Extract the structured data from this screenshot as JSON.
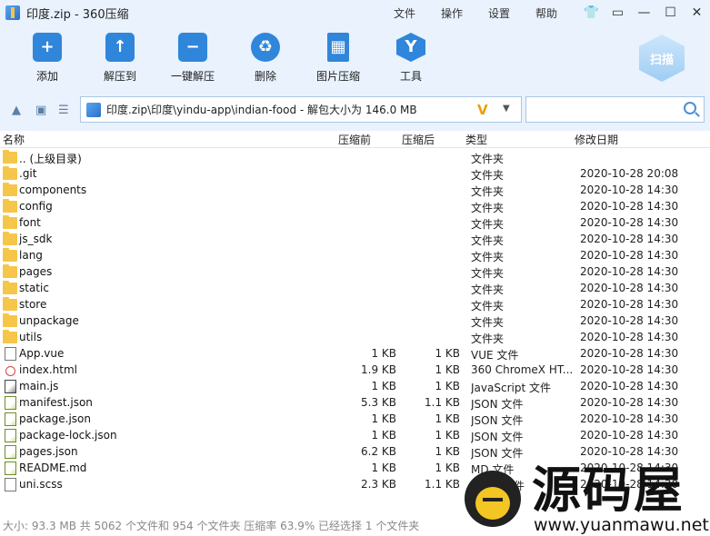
{
  "window": {
    "title": "印度.zip - 360压缩",
    "menu": [
      "文件",
      "操作",
      "设置",
      "帮助"
    ]
  },
  "toolbar": {
    "tools": [
      {
        "label": "添加",
        "icon": "add-icon"
      },
      {
        "label": "解压到",
        "icon": "extract-to-icon"
      },
      {
        "label": "一键解压",
        "icon": "one-click-extract-icon"
      },
      {
        "label": "删除",
        "icon": "trash-icon"
      },
      {
        "label": "图片压缩",
        "icon": "image-compress-icon"
      },
      {
        "label": "工具",
        "icon": "tools-icon"
      }
    ],
    "scan_label": "扫描"
  },
  "address": {
    "path": "印度.zip\\印度\\yindu-app\\indian-food - 解包大小为 146.0 MB",
    "search_placeholder": ""
  },
  "columns": {
    "name": "名称",
    "size": "压缩前",
    "compressed": "压缩后",
    "type": "类型",
    "date": "修改日期"
  },
  "rows": [
    {
      "name": ".. (上级目录)",
      "kind": "folder",
      "size": "",
      "compressed": "",
      "type": "文件夹",
      "date": ""
    },
    {
      "name": ".git",
      "kind": "folder",
      "size": "",
      "compressed": "",
      "type": "文件夹",
      "date": "2020-10-28 20:08"
    },
    {
      "name": "components",
      "kind": "folder",
      "size": "",
      "compressed": "",
      "type": "文件夹",
      "date": "2020-10-28 14:30"
    },
    {
      "name": "config",
      "kind": "folder",
      "size": "",
      "compressed": "",
      "type": "文件夹",
      "date": "2020-10-28 14:30"
    },
    {
      "name": "font",
      "kind": "folder",
      "size": "",
      "compressed": "",
      "type": "文件夹",
      "date": "2020-10-28 14:30"
    },
    {
      "name": "js_sdk",
      "kind": "folder",
      "size": "",
      "compressed": "",
      "type": "文件夹",
      "date": "2020-10-28 14:30"
    },
    {
      "name": "lang",
      "kind": "folder",
      "size": "",
      "compressed": "",
      "type": "文件夹",
      "date": "2020-10-28 14:30"
    },
    {
      "name": "pages",
      "kind": "folder",
      "size": "",
      "compressed": "",
      "type": "文件夹",
      "date": "2020-10-28 14:30"
    },
    {
      "name": "static",
      "kind": "folder",
      "size": "",
      "compressed": "",
      "type": "文件夹",
      "date": "2020-10-28 14:30"
    },
    {
      "name": "store",
      "kind": "folder",
      "size": "",
      "compressed": "",
      "type": "文件夹",
      "date": "2020-10-28 14:30"
    },
    {
      "name": "unpackage",
      "kind": "folder",
      "size": "",
      "compressed": "",
      "type": "文件夹",
      "date": "2020-10-28 14:30"
    },
    {
      "name": "utils",
      "kind": "folder",
      "size": "",
      "compressed": "",
      "type": "文件夹",
      "date": "2020-10-28 14:30"
    },
    {
      "name": "App.vue",
      "kind": "file",
      "size": "1 KB",
      "compressed": "1 KB",
      "type": "VUE 文件",
      "date": "2020-10-28 14:30"
    },
    {
      "name": "index.html",
      "kind": "html",
      "size": "1.9 KB",
      "compressed": "1 KB",
      "type": "360 ChromeX HT...",
      "date": "2020-10-28 14:30"
    },
    {
      "name": "main.js",
      "kind": "js",
      "size": "1 KB",
      "compressed": "1 KB",
      "type": "JavaScript 文件",
      "date": "2020-10-28 14:30"
    },
    {
      "name": "manifest.json",
      "kind": "json",
      "size": "5.3 KB",
      "compressed": "1.1 KB",
      "type": "JSON 文件",
      "date": "2020-10-28 14:30"
    },
    {
      "name": "package.json",
      "kind": "json",
      "size": "1 KB",
      "compressed": "1 KB",
      "type": "JSON 文件",
      "date": "2020-10-28 14:30"
    },
    {
      "name": "package-lock.json",
      "kind": "json",
      "size": "1 KB",
      "compressed": "1 KB",
      "type": "JSON 文件",
      "date": "2020-10-28 14:30"
    },
    {
      "name": "pages.json",
      "kind": "json",
      "size": "6.2 KB",
      "compressed": "1 KB",
      "type": "JSON 文件",
      "date": "2020-10-28 14:30"
    },
    {
      "name": "README.md",
      "kind": "json",
      "size": "1 KB",
      "compressed": "1 KB",
      "type": "MD 文件",
      "date": "2020-10-28 14:30"
    },
    {
      "name": "uni.scss",
      "kind": "file",
      "size": "2.3 KB",
      "compressed": "1.1 KB",
      "type": "SCSS 文件",
      "date": "2020-10-28 14:30"
    }
  ],
  "status": "大小: 93.3 MB 共 5062 个文件和 954 个文件夹 压缩率 63.9% 已经选择 1 个文件夹",
  "watermark": {
    "text": "源码屋",
    "url": "www.yuanmawu.net"
  }
}
